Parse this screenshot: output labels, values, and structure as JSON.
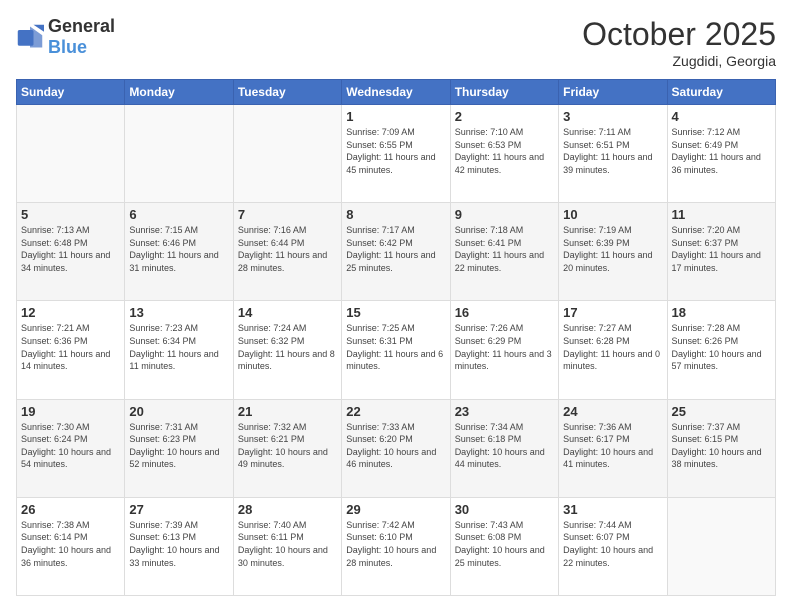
{
  "logo": {
    "general": "General",
    "blue": "Blue"
  },
  "header": {
    "month": "October 2025",
    "location": "Zugdidi, Georgia"
  },
  "weekdays": [
    "Sunday",
    "Monday",
    "Tuesday",
    "Wednesday",
    "Thursday",
    "Friday",
    "Saturday"
  ],
  "weeks": [
    [
      {
        "day": "",
        "info": ""
      },
      {
        "day": "",
        "info": ""
      },
      {
        "day": "",
        "info": ""
      },
      {
        "day": "1",
        "info": "Sunrise: 7:09 AM\nSunset: 6:55 PM\nDaylight: 11 hours and 45 minutes."
      },
      {
        "day": "2",
        "info": "Sunrise: 7:10 AM\nSunset: 6:53 PM\nDaylight: 11 hours and 42 minutes."
      },
      {
        "day": "3",
        "info": "Sunrise: 7:11 AM\nSunset: 6:51 PM\nDaylight: 11 hours and 39 minutes."
      },
      {
        "day": "4",
        "info": "Sunrise: 7:12 AM\nSunset: 6:49 PM\nDaylight: 11 hours and 36 minutes."
      }
    ],
    [
      {
        "day": "5",
        "info": "Sunrise: 7:13 AM\nSunset: 6:48 PM\nDaylight: 11 hours and 34 minutes."
      },
      {
        "day": "6",
        "info": "Sunrise: 7:15 AM\nSunset: 6:46 PM\nDaylight: 11 hours and 31 minutes."
      },
      {
        "day": "7",
        "info": "Sunrise: 7:16 AM\nSunset: 6:44 PM\nDaylight: 11 hours and 28 minutes."
      },
      {
        "day": "8",
        "info": "Sunrise: 7:17 AM\nSunset: 6:42 PM\nDaylight: 11 hours and 25 minutes."
      },
      {
        "day": "9",
        "info": "Sunrise: 7:18 AM\nSunset: 6:41 PM\nDaylight: 11 hours and 22 minutes."
      },
      {
        "day": "10",
        "info": "Sunrise: 7:19 AM\nSunset: 6:39 PM\nDaylight: 11 hours and 20 minutes."
      },
      {
        "day": "11",
        "info": "Sunrise: 7:20 AM\nSunset: 6:37 PM\nDaylight: 11 hours and 17 minutes."
      }
    ],
    [
      {
        "day": "12",
        "info": "Sunrise: 7:21 AM\nSunset: 6:36 PM\nDaylight: 11 hours and 14 minutes."
      },
      {
        "day": "13",
        "info": "Sunrise: 7:23 AM\nSunset: 6:34 PM\nDaylight: 11 hours and 11 minutes."
      },
      {
        "day": "14",
        "info": "Sunrise: 7:24 AM\nSunset: 6:32 PM\nDaylight: 11 hours and 8 minutes."
      },
      {
        "day": "15",
        "info": "Sunrise: 7:25 AM\nSunset: 6:31 PM\nDaylight: 11 hours and 6 minutes."
      },
      {
        "day": "16",
        "info": "Sunrise: 7:26 AM\nSunset: 6:29 PM\nDaylight: 11 hours and 3 minutes."
      },
      {
        "day": "17",
        "info": "Sunrise: 7:27 AM\nSunset: 6:28 PM\nDaylight: 11 hours and 0 minutes."
      },
      {
        "day": "18",
        "info": "Sunrise: 7:28 AM\nSunset: 6:26 PM\nDaylight: 10 hours and 57 minutes."
      }
    ],
    [
      {
        "day": "19",
        "info": "Sunrise: 7:30 AM\nSunset: 6:24 PM\nDaylight: 10 hours and 54 minutes."
      },
      {
        "day": "20",
        "info": "Sunrise: 7:31 AM\nSunset: 6:23 PM\nDaylight: 10 hours and 52 minutes."
      },
      {
        "day": "21",
        "info": "Sunrise: 7:32 AM\nSunset: 6:21 PM\nDaylight: 10 hours and 49 minutes."
      },
      {
        "day": "22",
        "info": "Sunrise: 7:33 AM\nSunset: 6:20 PM\nDaylight: 10 hours and 46 minutes."
      },
      {
        "day": "23",
        "info": "Sunrise: 7:34 AM\nSunset: 6:18 PM\nDaylight: 10 hours and 44 minutes."
      },
      {
        "day": "24",
        "info": "Sunrise: 7:36 AM\nSunset: 6:17 PM\nDaylight: 10 hours and 41 minutes."
      },
      {
        "day": "25",
        "info": "Sunrise: 7:37 AM\nSunset: 6:15 PM\nDaylight: 10 hours and 38 minutes."
      }
    ],
    [
      {
        "day": "26",
        "info": "Sunrise: 7:38 AM\nSunset: 6:14 PM\nDaylight: 10 hours and 36 minutes."
      },
      {
        "day": "27",
        "info": "Sunrise: 7:39 AM\nSunset: 6:13 PM\nDaylight: 10 hours and 33 minutes."
      },
      {
        "day": "28",
        "info": "Sunrise: 7:40 AM\nSunset: 6:11 PM\nDaylight: 10 hours and 30 minutes."
      },
      {
        "day": "29",
        "info": "Sunrise: 7:42 AM\nSunset: 6:10 PM\nDaylight: 10 hours and 28 minutes."
      },
      {
        "day": "30",
        "info": "Sunrise: 7:43 AM\nSunset: 6:08 PM\nDaylight: 10 hours and 25 minutes."
      },
      {
        "day": "31",
        "info": "Sunrise: 7:44 AM\nSunset: 6:07 PM\nDaylight: 10 hours and 22 minutes."
      },
      {
        "day": "",
        "info": ""
      }
    ]
  ]
}
